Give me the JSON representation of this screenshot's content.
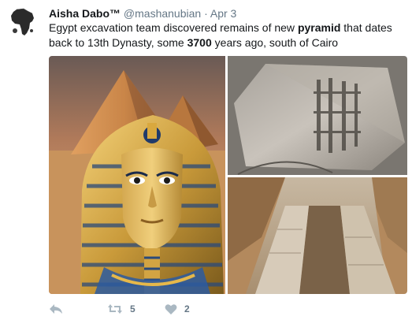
{
  "tweet": {
    "author_name": "Aisha Dabo™",
    "author_handle": "@mashanubian",
    "separator": "·",
    "date": "Apr 3",
    "text_parts": [
      "Egypt excavation team discovered remains of new ",
      "pyramid",
      " that dates back to 13th Dynasty, some ",
      "3700",
      " years ago, south of Cairo"
    ]
  },
  "media": {
    "images": [
      {
        "subject": "pyramids-and-golden-mask"
      },
      {
        "subject": "inscribed-stone-block"
      },
      {
        "subject": "excavation-trench"
      }
    ]
  },
  "actions": {
    "reply_icon": "reply-icon",
    "retweet_icon": "retweet-icon",
    "retweet_count": "5",
    "like_icon": "heart-icon",
    "like_count": "2"
  },
  "colors": {
    "text": "#14171a",
    "muted": "#657786",
    "action_icon": "#aab8c2"
  }
}
